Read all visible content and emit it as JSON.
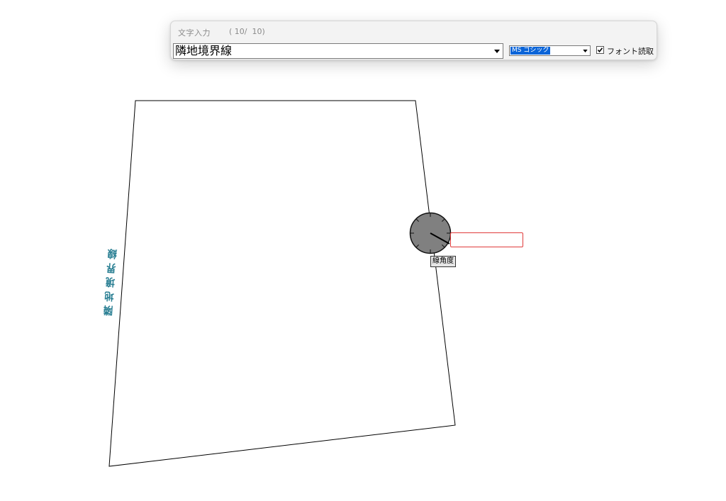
{
  "toolbar": {
    "title": "文字入力",
    "counter": "( 10/  10)",
    "text_value": "隣地境界線",
    "font_value": "MS ゴシック",
    "font_read_checked": true,
    "font_read_label": "フォント読取"
  },
  "canvas": {
    "placed_text": "隣地境界線",
    "placed_text_color": "#2a7f93",
    "line_color": "#000000"
  },
  "angle_tool": {
    "tooltip": "線角度",
    "input_value": "",
    "dial_fill": "#808080",
    "input_border_color": "#e03a3a"
  },
  "colors": {
    "selection": "#0a64d8",
    "toolbar_bg": "#f3f3f3"
  }
}
